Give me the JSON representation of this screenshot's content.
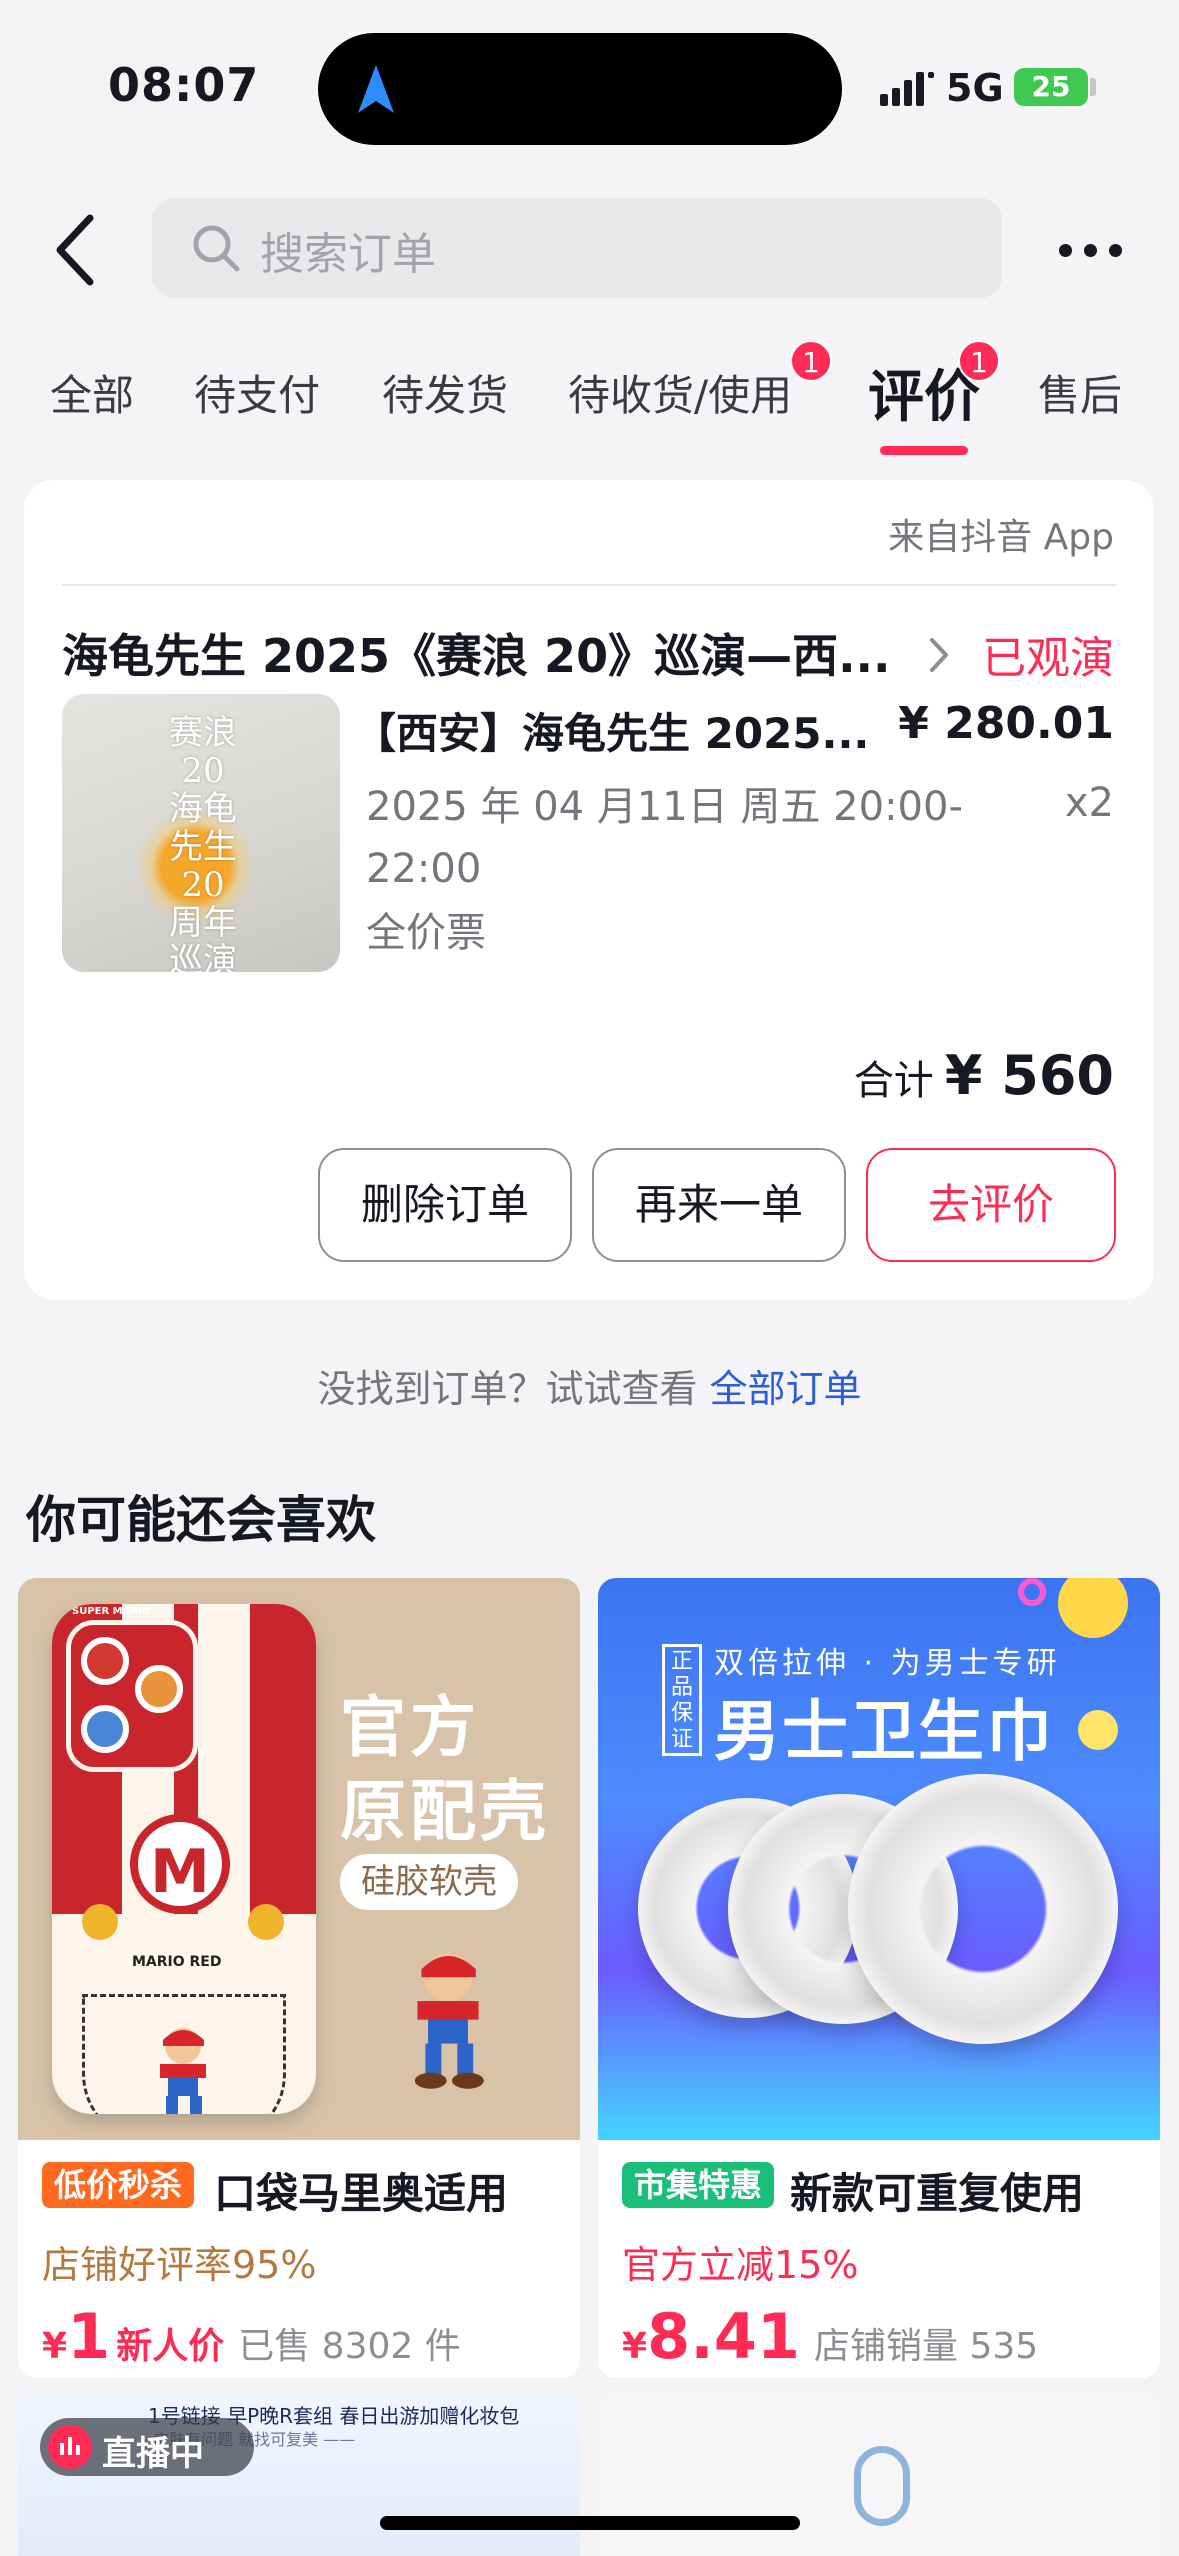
{
  "status_bar": {
    "time": "08:07",
    "network": "5G",
    "battery": "25"
  },
  "search": {
    "placeholder": "搜索订单"
  },
  "tabs": [
    {
      "label": "全部"
    },
    {
      "label": "待支付"
    },
    {
      "label": "待发货"
    },
    {
      "label": "待收货/使用",
      "badge": "1"
    },
    {
      "label": "评价",
      "badge": "1",
      "active": true
    },
    {
      "label": "售后"
    }
  ],
  "order": {
    "source": "来自抖音 App",
    "title": "海龟先生 2025《赛浪 20》巡演—西...",
    "status": "已观演",
    "image_text": "赛浪 20 海龟先生 20周年巡演",
    "product_name": "【西安】海龟先生 2025...",
    "price": "¥ 280.01",
    "date": "2025 年 04 月11日 周五 20:00-22:00",
    "quantity": "x2",
    "spec": "全价票",
    "total_label": "合计",
    "total_amount": "¥ 560",
    "buttons": {
      "delete": "删除订单",
      "reorder": "再来一单",
      "review": "去评价"
    }
  },
  "hint": {
    "text": "没找到订单？试试查看 ",
    "link": "全部订单"
  },
  "recommend": {
    "title": "你可能还会喜欢",
    "items": [
      {
        "tag": "低价秒杀",
        "tag_color": "#ff6a1f",
        "name": "口袋马里奥适用",
        "sub": "店铺好评率95%",
        "sub_color": "#b5793f",
        "price": "1",
        "price_extra": "新人价",
        "sold": "已售 8302 件",
        "image": {
          "title1": "官方",
          "title2": "原配壳",
          "pill": "硅胶软壳",
          "case_text_top": "SUPER MARIO",
          "case_text_label": "MARIO RED",
          "case_badge": "M"
        }
      },
      {
        "tag": "市集特惠",
        "tag_color": "#1cbf7a",
        "name": "新款可重复使用",
        "sub": "官方立减15%",
        "sub_color": "#fe2c55",
        "price": "8.41",
        "price_extra": "",
        "sold": "店铺销量 535",
        "image": {
          "stamp": "正品保证",
          "subtitle": "双倍拉伸 · 为男士专研",
          "title": "男士卫生巾"
        }
      }
    ],
    "live": {
      "label": "直播中",
      "banner_text": "1号链接  早P晚R套组  春日出游加赠化妆包",
      "banner_sub": "·皮肤有问题  就找可复美  ——"
    }
  }
}
